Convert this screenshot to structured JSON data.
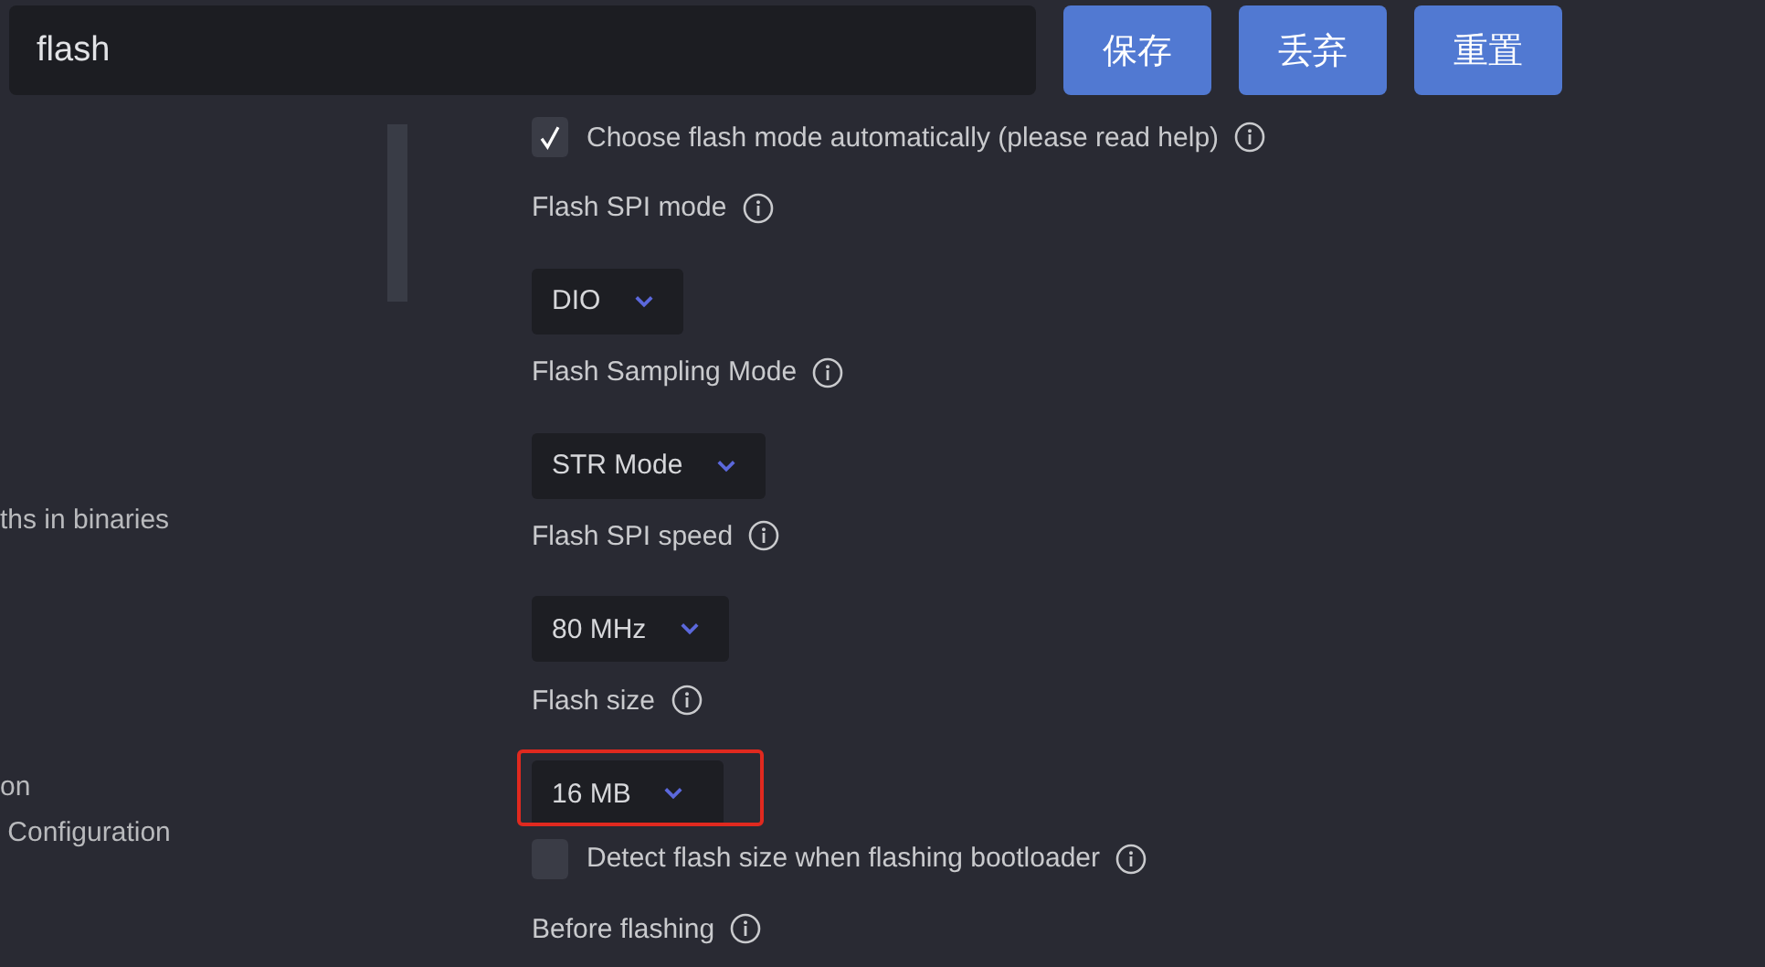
{
  "search": {
    "value": "flash"
  },
  "buttons": [
    "保存",
    "丢弃",
    "重置"
  ],
  "sidebar": {
    "items": [
      "ths in binaries",
      "on",
      " Configuration"
    ]
  },
  "settings": [
    {
      "kind": "checkbox",
      "label": "Choose flash mode automatically (please read help)",
      "checked": true
    },
    {
      "kind": "label",
      "label": "Flash SPI mode"
    },
    {
      "kind": "select",
      "value": "DIO",
      "highlighted": false
    },
    {
      "kind": "label",
      "label": "Flash Sampling Mode"
    },
    {
      "kind": "select",
      "value": "STR Mode",
      "highlighted": false
    },
    {
      "kind": "label",
      "label": "Flash SPI speed"
    },
    {
      "kind": "select",
      "value": "80 MHz",
      "highlighted": false
    },
    {
      "kind": "label",
      "label": "Flash size"
    },
    {
      "kind": "select",
      "value": "16 MB",
      "highlighted": true
    },
    {
      "kind": "checkbox",
      "label": "Detect flash size when flashing bootloader",
      "checked": false
    },
    {
      "kind": "label",
      "label": "Before flashing"
    }
  ]
}
